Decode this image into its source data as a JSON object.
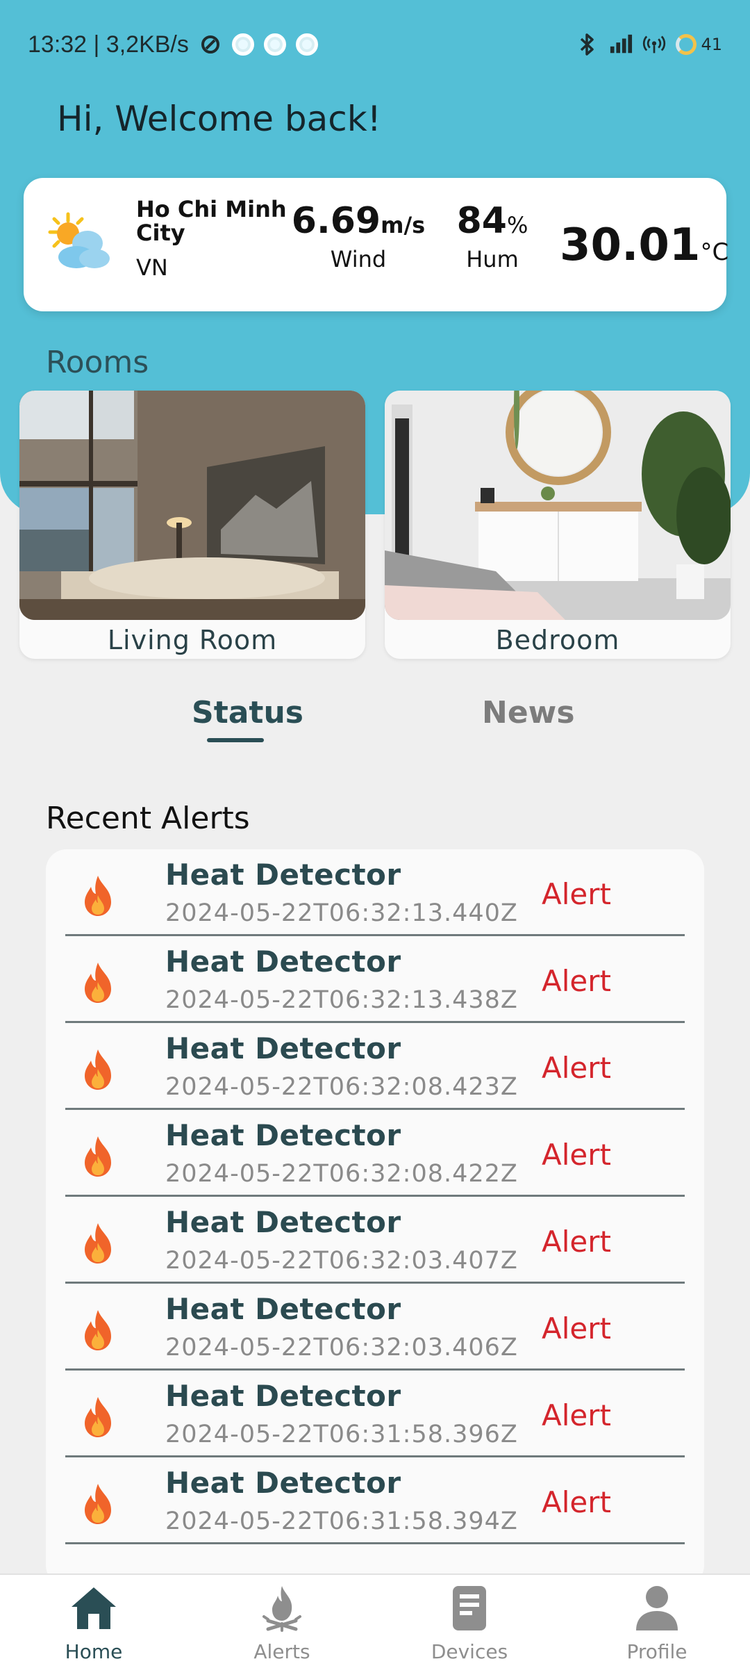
{
  "status_bar": {
    "time_speed": "13:32 | 3,2KB/s",
    "battery": "41"
  },
  "greeting": "Hi, Welcome back!",
  "weather": {
    "city": "Ho Chi Minh City",
    "country": "VN",
    "wind_value": "6.69",
    "wind_unit": "m/s",
    "wind_label": "Wind",
    "humidity_value": "84",
    "humidity_unit": "%",
    "humidity_label": "Hum",
    "temp_value": "30.01",
    "temp_unit": "°C",
    "icon": "partly-cloudy-icon"
  },
  "rooms": {
    "title": "Rooms",
    "items": [
      {
        "label": "Living Room"
      },
      {
        "label": "Bedroom"
      }
    ]
  },
  "tabs": {
    "status": "Status",
    "news": "News",
    "active": "Status"
  },
  "alerts": {
    "title": "Recent Alerts",
    "items": [
      {
        "name": "Heat Detector",
        "time": "2024-05-22T06:32:13.440Z",
        "status": "Alert"
      },
      {
        "name": "Heat Detector",
        "time": "2024-05-22T06:32:13.438Z",
        "status": "Alert"
      },
      {
        "name": "Heat Detector",
        "time": "2024-05-22T06:32:08.423Z",
        "status": "Alert"
      },
      {
        "name": "Heat Detector",
        "time": "2024-05-22T06:32:08.422Z",
        "status": "Alert"
      },
      {
        "name": "Heat Detector",
        "time": "2024-05-22T06:32:03.407Z",
        "status": "Alert"
      },
      {
        "name": "Heat Detector",
        "time": "2024-05-22T06:32:03.406Z",
        "status": "Alert"
      },
      {
        "name": "Heat Detector",
        "time": "2024-05-22T06:31:58.396Z",
        "status": "Alert"
      },
      {
        "name": "Heat Detector",
        "time": "2024-05-22T06:31:58.394Z",
        "status": "Alert"
      }
    ]
  },
  "nav": {
    "home": "Home",
    "alerts": "Alerts",
    "devices": "Devices",
    "profile": "Profile"
  },
  "colors": {
    "header": "#54bfd6",
    "accent": "#2a4e55",
    "alert": "#d4252c"
  }
}
